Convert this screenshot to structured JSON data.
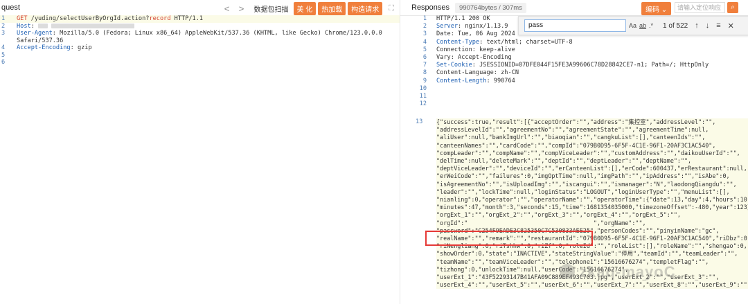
{
  "request": {
    "title": "quest",
    "tools": {
      "prev": "<",
      "next": ">",
      "label": "数据包扫描",
      "buttons": [
        "美 化",
        "热加载",
        "构造请求"
      ],
      "expand": "⛶"
    },
    "lines": [
      {
        "n": "1",
        "method": "GET",
        "rest": " /yuding/selectUserByOrgId.action?",
        "param": "record",
        "proto": " HTTP/1.1"
      },
      {
        "n": "2",
        "key": "Host",
        "sep": ": "
      },
      {
        "n": "3",
        "key": "User-Agent",
        "value": ": Mozilla/5.0 (Fedora; Linux x86_64) AppleWebKit/537.36 (KHTML, like Gecko) Chrome/123.0.0.0 ",
        "cont": "Safari/537.36"
      },
      {
        "n": "4",
        "key": "Accept-Encoding",
        "value": ": gzip"
      },
      {
        "n": "5"
      },
      {
        "n": "6"
      }
    ]
  },
  "response": {
    "title": "Responses",
    "stats": "990764bytes / 307ms",
    "encode_btn": "编码",
    "locate_placeholder": "请输入定位响应",
    "find": {
      "value": "pass",
      "opts": [
        "Aa",
        "ab",
        ".*"
      ],
      "count": "1 of 522",
      "nav": [
        "↑",
        "↓",
        "≡",
        "✕"
      ]
    },
    "headers": [
      {
        "n": "1",
        "text": "HTTP/1.1 200 OK"
      },
      {
        "n": "2",
        "key": "Server",
        "value": ": nginx/1.13.9"
      },
      {
        "n": "3",
        "text": "Date: Tue, 06 Aug 2024 02:13:05 GMT"
      },
      {
        "n": "4",
        "key": "Content-Type",
        "value": ": text/html; charset=UTF-8"
      },
      {
        "n": "5",
        "text": "Connection: keep-alive"
      },
      {
        "n": "6",
        "text": "Vary: Accept-Encoding"
      },
      {
        "n": "7",
        "key": "Set-Cookie",
        "value": ": JSESSIONID=07DFE044F15FE3A99606C78D28842CE7-n1; Path=/; HttpOnly"
      },
      {
        "n": "8",
        "text": "Content-Language: zh-CN"
      },
      {
        "n": "9",
        "key": "Content-Length",
        "value": ": 990764"
      },
      {
        "n": "10",
        "text": ""
      },
      {
        "n": "11",
        "text": ""
      },
      {
        "n": "12",
        "text": ""
      }
    ],
    "json_line_no": "13",
    "json_lines": [
      "{\"success\":true,\"result\":[{\"acceptOrder\":\"\",\"address\":\"集控室\",\"addressLevel\":\"\",",
      "\"addressLevelId\":\"\",\"agreementNo\":\"\",\"agreementState\":\"\",\"agreementTime\":null,",
      "\"aliUser\":null,\"bankImgUrl\":\"\",\"biaoqian\":\"\",\"cangkuList\":[],\"canteenIds\":\"\",",
      "\"canteenNames\":\"\",\"cardCode\":\"\",\"compId\":\"079B0D95-6F5F-4C1E-96F1-20AF3C1AC540\",",
      "\"compLeader\":\"\",\"compName\":\"\",\"compViceLeader\":\"\",\"customAddress\":\"\",\"daikouUserId\":\"\",",
      "\"delTime\":null,\"deleteMark\":\"\",\"deptId\":\"\",\"deptLeader\":\"\",\"deptName\":\"\",",
      "\"deptViceLeader\":\"\",\"deviceId\":\"\",\"erCanteenList\":[],\"erCode\":600437,\"erRestaurant\":null,",
      "\"erWeiCode\":\"\",\"failures\":0,\"imgOptTime\":null,\"imgPath\":\"\",\"ipAddress\":\"\",\"isAbe\":0,",
      "\"isAgreementNo\":\"\",\"isUploadImg\":\"\",\"iscangui\":\"\",\"ismanager\":\"N\",\"laodongQiangdu\":\"\",",
      "\"leader\":\"\",\"lockTime\":null,\"loginStatus\":\"LOGOUT\",\"loginUserType\":\"\",\"menuList\":[],",
      "\"nianling\":0,\"operator\":\"\",\"operatorName\":\"\",\"operatorTime\":{\"date\":13,\"day\":4,\"hours\":10,",
      "\"minutes\":47,\"month\":3,\"seconds\":15,\"time\":1681354035000,\"timezoneOffset\":-480,\"year\":123},",
      "\"orgExt_1\":\"\",\"orgExt_2\":\"\",\"orgExt_3\":\"\",\"orgExt_4\":\"\",\"orgExt_5\":\"\",",
      "\"orgId\":\"                                    \",\"orgName\":\"\",",
      "\"password\":\"C254F9EADE3C825350C7C530833AEE25\",\"personCodes\":\"\",\"pinyinName\":\"gc\",",
      "\"realName\":\"\",\"remark\":\"\",\"restaurantId\":\"079B0D95-6F5F-4C1E-96F1-20AF3C1AC540\",\"riDbz\":0,",
      "\"riNengliang\":0,\"riTshhw\":0,\"riZf\":0,\"roleId\":\"\",\"roleList\":[],\"roleName\":\"\",\"shengao\":0,",
      "\"showOrder\":0,\"state\":\"INACTIVE\",\"stateStringValue\":\"停用\",\"teamId\":\"\",\"teamLeader\":\"\",",
      "\"teamName\":\"\",\"teamViceLeader\":\"\",\"telephone1\":\"15616676274\",\"templetFlag\":\"\",",
      "\"tizhong\":0,\"unlockTime\":null,\"userCode\":\"15616676274\",",
      "\"userExt_1\":\"43F52293147B41AFA09C889EF493C703.jpg\",\"userExt_2\":\"\",\"userExt_3\":\"\",",
      "\"userExt_4\":\"\",\"userExt_5\":\"\",\"userExt_6\":\"\",\"userExt_7\":\"\",\"userExt_8\":\"\",\"userExt_9\":\"\""
    ],
    "watermark": "zkaq-mayoC"
  },
  "colors": {
    "accent": "#f07f3c",
    "highlight_box": "#e53935",
    "key_blue": "#1d5fb3",
    "key_red": "#d5402f"
  }
}
